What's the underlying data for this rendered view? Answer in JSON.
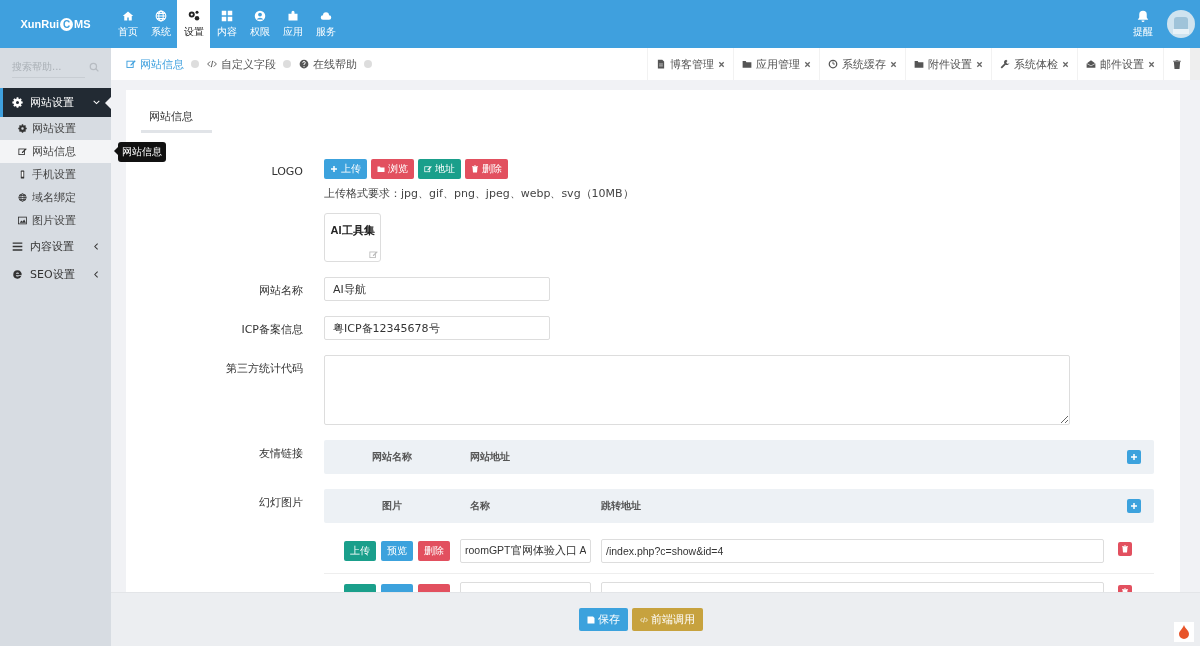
{
  "topbar": {
    "logo": {
      "before": "XunRui",
      "mark": "C",
      "after": "MS"
    },
    "nav": [
      {
        "label": "首页",
        "selected": false
      },
      {
        "label": "系统",
        "selected": false
      },
      {
        "label": "设置",
        "selected": true
      },
      {
        "label": "内容",
        "selected": false
      },
      {
        "label": "权限",
        "selected": false
      },
      {
        "label": "应用",
        "selected": false
      },
      {
        "label": "服务",
        "selected": false
      }
    ],
    "alert": "提醒"
  },
  "sidebar": {
    "search_placeholder": "搜索帮助...",
    "menu": [
      {
        "label": "网站设置",
        "expanded": true,
        "children": [
          {
            "label": "网站设置",
            "selected": false
          },
          {
            "label": "网站信息",
            "selected": true
          },
          {
            "label": "手机设置",
            "selected": false
          },
          {
            "label": "域名绑定",
            "selected": false
          },
          {
            "label": "图片设置",
            "selected": false
          }
        ]
      },
      {
        "label": "内容设置",
        "expanded": false
      },
      {
        "label": "SEO设置",
        "expanded": false
      }
    ],
    "tooltip": "网站信息"
  },
  "breadcrumb": [
    {
      "label": "网站信息",
      "selected": true
    },
    {
      "label": "自定义字段",
      "selected": false
    },
    {
      "label": "在线帮助",
      "selected": false
    }
  ],
  "open_tabs": [
    {
      "label": "博客管理"
    },
    {
      "label": "应用管理"
    },
    {
      "label": "系统缓存"
    },
    {
      "label": "附件设置"
    },
    {
      "label": "系统体检"
    },
    {
      "label": "邮件设置"
    }
  ],
  "card": {
    "tab": "网站信息",
    "fields": [
      {
        "kind": "logo",
        "label": "LOGO",
        "buttons": [
          {
            "label": "上传",
            "color": "#3ca2dd"
          },
          {
            "label": "浏览",
            "color": "#e2505f"
          },
          {
            "label": "地址",
            "color": "#1a9f8b"
          },
          {
            "label": "删除",
            "color": "#e2505f"
          }
        ],
        "hint": "上传格式要求：jpg、gif、png、jpeg、webp、svg（10MB）",
        "preview": "AI工具集"
      },
      {
        "kind": "text",
        "label": "网站名称",
        "value": "AI导航"
      },
      {
        "kind": "text",
        "label": "ICP备案信息",
        "value": "粤ICP备12345678号"
      },
      {
        "kind": "textarea",
        "label": "第三方统计代码"
      },
      {
        "kind": "table",
        "label": "友情链接",
        "columns": [
          "网站名称",
          "网站地址"
        ]
      },
      {
        "kind": "table",
        "label": "幻灯图片",
        "columns": [
          "图片",
          "名称",
          "跳转地址"
        ],
        "rows": [
          {
            "kind": "full",
            "buttons": [
              {
                "label": "上传",
                "color": "#1a9f8b"
              },
              {
                "label": "预览",
                "color": "#3ca2dd"
              },
              {
                "label": "删除",
                "color": "#e2505f"
              }
            ],
            "name": "roomGPT官网体验入口 A",
            "url": "/index.php?c=show&id=4"
          },
          {
            "kind": "cut",
            "buttons": [
              {
                "color": "#1a9f8b"
              },
              {
                "color": "#3ca2dd"
              },
              {
                "color": "#e2505f"
              }
            ]
          }
        ]
      }
    ]
  },
  "footer": [
    {
      "label": "保存",
      "color": "#3ca2dd"
    },
    {
      "label": "前端调用",
      "color": "#c7a23e"
    }
  ]
}
